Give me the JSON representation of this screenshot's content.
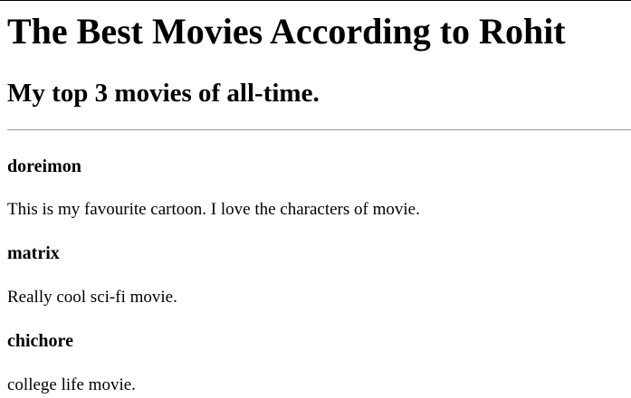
{
  "page": {
    "title": "The Best Movies According to Rohit",
    "subtitle": "My top 3 movies of all-time."
  },
  "movies": [
    {
      "title": "doreimon",
      "description": "This is my favourite cartoon. I love the characters of movie."
    },
    {
      "title": "matrix",
      "description": "Really cool sci-fi movie."
    },
    {
      "title": "chichore",
      "description": "college life movie."
    }
  ]
}
